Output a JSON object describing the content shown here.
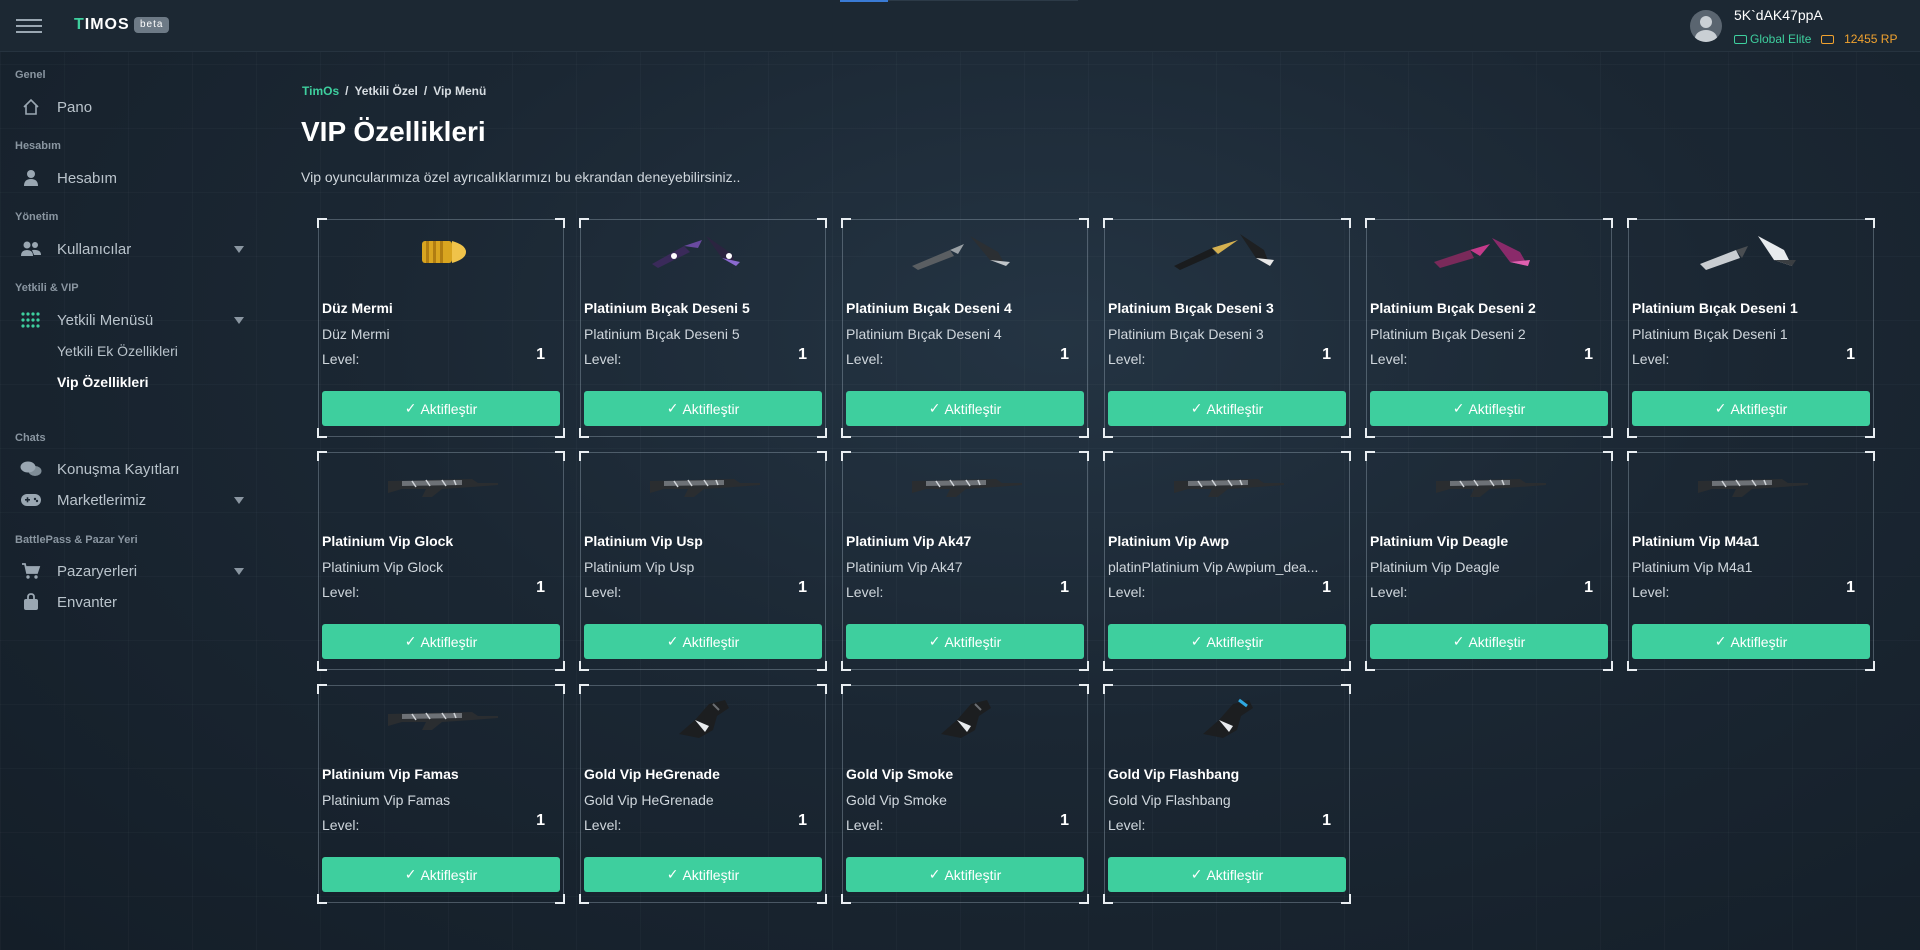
{
  "app": {
    "brand_first": "T",
    "brand_rest": "IMOS",
    "badge": "beta"
  },
  "user": {
    "name": "5K`dAK47ppA",
    "rank": "Global Elite",
    "rp_value": "12455",
    "rp_unit": "RP"
  },
  "sidebar": {
    "sections": [
      {
        "title": "Genel",
        "items": [
          {
            "label": "Pano",
            "icon": "home-icon"
          }
        ]
      },
      {
        "title": "Hesabım",
        "items": [
          {
            "label": "Hesabım",
            "icon": "user-icon"
          }
        ]
      },
      {
        "title": "Yönetim",
        "items": [
          {
            "label": "Kullanıcılar",
            "icon": "users-icon"
          }
        ]
      },
      {
        "title": "Yetkili & VIP",
        "items": [
          {
            "label": "Yetkili Menüsü",
            "icon": "grid-icon"
          }
        ],
        "subitems": [
          "Yetkili Ek Özellikleri",
          "Vip Özellikleri"
        ]
      },
      {
        "title": "Chats",
        "items": [
          {
            "label": "Konuşma Kayıtları",
            "icon": "chat-icon"
          },
          {
            "label": "Marketlerimiz",
            "icon": "gamepad-icon"
          }
        ]
      },
      {
        "title": "BattlePass & Pazar Yeri",
        "items": [
          {
            "label": "Pazaryerleri",
            "icon": "cart-icon"
          },
          {
            "label": "Envanter",
            "icon": "bag-icon"
          }
        ]
      }
    ]
  },
  "breadcrumb": [
    "TimOs",
    "Yetkili Özel",
    "Vip Menü"
  ],
  "page": {
    "title": "VIP Özellikleri",
    "subtitle": "Vip oyuncularımıza özel ayrıcalıklarımızı bu ekrandan deneyebilirsiniz.."
  },
  "level_label": "Level:",
  "button_label": "Aktifleştir",
  "accent_color": "#3ecf9e",
  "cards": [
    {
      "title": "Düz Mermi",
      "desc": "Düz Mermi",
      "level": "1",
      "image": "bullet"
    },
    {
      "title": "Platinium Bıçak Deseni 5",
      "desc": "Platinium Bıçak Deseni 5",
      "level": "1",
      "image": "knife-purple"
    },
    {
      "title": "Platinium Bıçak Deseni 4",
      "desc": "Platinium Bıçak Deseni 4",
      "level": "1",
      "image": "knife-gray"
    },
    {
      "title": "Platinium Bıçak Deseni 3",
      "desc": "Platinium Bıçak Deseni 3",
      "level": "1",
      "image": "knife-black"
    },
    {
      "title": "Platinium Bıçak Deseni 2",
      "desc": "Platinium Bıçak Deseni 2",
      "level": "1",
      "image": "knife-pink"
    },
    {
      "title": "Platinium Bıçak Deseni 1",
      "desc": "Platinium Bıçak Deseni 1",
      "level": "1",
      "image": "knife-white"
    },
    {
      "title": "Platinium Vip Glock",
      "desc": "Platinium Vip Glock",
      "level": "1",
      "image": "rifle"
    },
    {
      "title": "Platinium Vip Usp",
      "desc": "Platinium Vip Usp",
      "level": "1",
      "image": "rifle"
    },
    {
      "title": "Platinium Vip Ak47",
      "desc": "Platinium Vip Ak47",
      "level": "1",
      "image": "rifle"
    },
    {
      "title": "Platinium Vip Awp",
      "desc": "platinPlatinium Vip Awpium_dea...",
      "level": "1",
      "image": "rifle"
    },
    {
      "title": "Platinium Vip Deagle",
      "desc": "Platinium Vip Deagle",
      "level": "1",
      "image": "rifle"
    },
    {
      "title": "Platinium Vip M4a1",
      "desc": "Platinium Vip M4a1",
      "level": "1",
      "image": "rifle"
    },
    {
      "title": "Platinium Vip Famas",
      "desc": "Platinium Vip Famas",
      "level": "1",
      "image": "rifle"
    },
    {
      "title": "Gold Vip HeGrenade",
      "desc": "Gold Vip HeGrenade",
      "level": "1",
      "image": "glove"
    },
    {
      "title": "Gold Vip Smoke",
      "desc": "Gold Vip Smoke",
      "level": "1",
      "image": "glove"
    },
    {
      "title": "Gold Vip Flashbang",
      "desc": "Gold Vip Flashbang",
      "level": "1",
      "image": "glove-blue"
    }
  ]
}
